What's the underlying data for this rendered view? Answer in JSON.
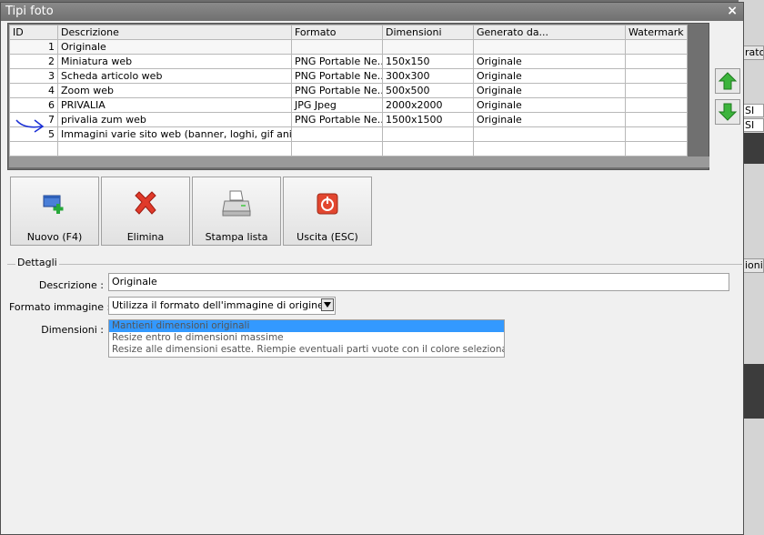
{
  "window": {
    "title": "Tipi foto",
    "close_glyph": "×"
  },
  "grid": {
    "columns": [
      "ID",
      "Descrizione",
      "Formato",
      "Dimensioni",
      "Generato da...",
      "Watermark"
    ],
    "rows": [
      {
        "id": "1",
        "descrizione": "Originale",
        "formato": "",
        "dimensioni": "",
        "generato": "",
        "watermark": ""
      },
      {
        "id": "2",
        "descrizione": "Miniatura web",
        "formato": "PNG Portable Ne...",
        "dimensioni": "150x150",
        "generato": "Originale",
        "watermark": ""
      },
      {
        "id": "3",
        "descrizione": "Scheda articolo web",
        "formato": "PNG Portable Ne...",
        "dimensioni": "300x300",
        "generato": "Originale",
        "watermark": ""
      },
      {
        "id": "4",
        "descrizione": "Zoom web",
        "formato": "PNG Portable Ne...",
        "dimensioni": "500x500",
        "generato": "Originale",
        "watermark": ""
      },
      {
        "id": "6",
        "descrizione": "PRIVALIA",
        "formato": "JPG Jpeg",
        "dimensioni": "2000x2000",
        "generato": "Originale",
        "watermark": ""
      },
      {
        "id": "7",
        "descrizione": "privalia zum web",
        "formato": "PNG Portable Ne...",
        "dimensioni": "1500x1500",
        "generato": "Originale",
        "watermark": ""
      },
      {
        "id": "5",
        "descrizione": "Immagini varie sito web (banner, loghi, gif animat...",
        "formato": "",
        "dimensioni": "",
        "generato": "",
        "watermark": ""
      },
      {
        "id": "",
        "descrizione": "",
        "formato": "",
        "dimensioni": "",
        "generato": "",
        "watermark": ""
      }
    ]
  },
  "side": {
    "up_icon": "arrow-up-icon",
    "down_icon": "arrow-down-icon"
  },
  "toolbar": {
    "nuovo_label": "Nuovo (F4)",
    "elimina_label": "Elimina",
    "stampa_label": "Stampa lista",
    "uscita_label": "Uscita (ESC)"
  },
  "details": {
    "group_title": "Dettagli",
    "descrizione_label": "Descrizione :",
    "descrizione_value": "Originale",
    "formato_label": "Formato immagine :",
    "formato_value": "Utilizza il formato dell'immagine di origine",
    "dimensioni_label": "Dimensioni :",
    "dimensioni_options": [
      "Mantieni dimensioni originali",
      "Resize entro le dimensioni massime",
      "Resize alle dimensioni esatte. Riempie eventuali parti vuote con il colore selezionato."
    ],
    "dimensioni_selected": 0
  },
  "background": {
    "header_1": "rato",
    "cell_1": "SI",
    "cell_2": "SI",
    "header_2": "ioni"
  },
  "colors": {
    "accent": "#3399ff",
    "titlebar": "#7a7a7a",
    "grid_bg": "#707070",
    "green_arrow": "#3cb43c",
    "red_x": "#e03a2a"
  }
}
